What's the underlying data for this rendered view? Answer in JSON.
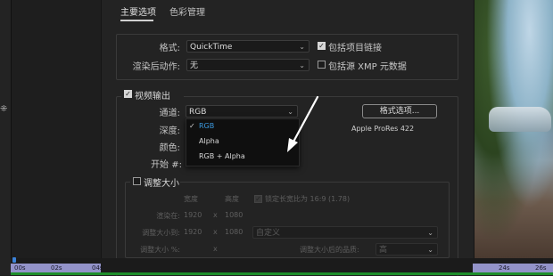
{
  "tabs": {
    "main": "主要选项",
    "color": "色彩管理"
  },
  "format": {
    "label": "格式:",
    "value": "QuickTime",
    "include_project_link": "包括项目链接",
    "include_project_link_checked": true
  },
  "post_render": {
    "label": "渲染后动作:",
    "value": "无",
    "include_xmp": "包括源 XMP 元数据",
    "include_xmp_checked": false
  },
  "video_output": {
    "label": "视频输出",
    "checked": true,
    "channels_label": "通道:",
    "channels_value": "RGB",
    "depth_label": "深度:",
    "color_label": "颜色:",
    "start_label": "开始 #:",
    "format_options_button": "格式选项...",
    "codec_info": "Apple ProRes 422"
  },
  "channels_dropdown": {
    "options": [
      "RGB",
      "Alpha",
      "RGB + Alpha"
    ],
    "selected": "RGB"
  },
  "resize": {
    "label": "调整大小",
    "checked": false,
    "col_width": "宽度",
    "col_height": "高度",
    "lock_aspect": "锁定长宽比为 16:9 (1.78)",
    "lock_aspect_checked": true,
    "rendering_at_label": "渲染在:",
    "rendering_w": "1920",
    "rendering_x": "x",
    "rendering_h": "1080",
    "resize_to_label": "调整大小到:",
    "resize_to_w": "1920",
    "resize_to_x": "x",
    "resize_to_h": "1080",
    "resize_to_preset": "自定义",
    "resize_pct_label": "调整大小 %:",
    "resize_pct_x": "x",
    "quality_label": "调整大小后的品质:",
    "quality_value": "高"
  },
  "timeline": {
    "labels_left": [
      "00s",
      "02s",
      "04s"
    ],
    "labels_right": [
      "24s",
      "26s"
    ]
  }
}
